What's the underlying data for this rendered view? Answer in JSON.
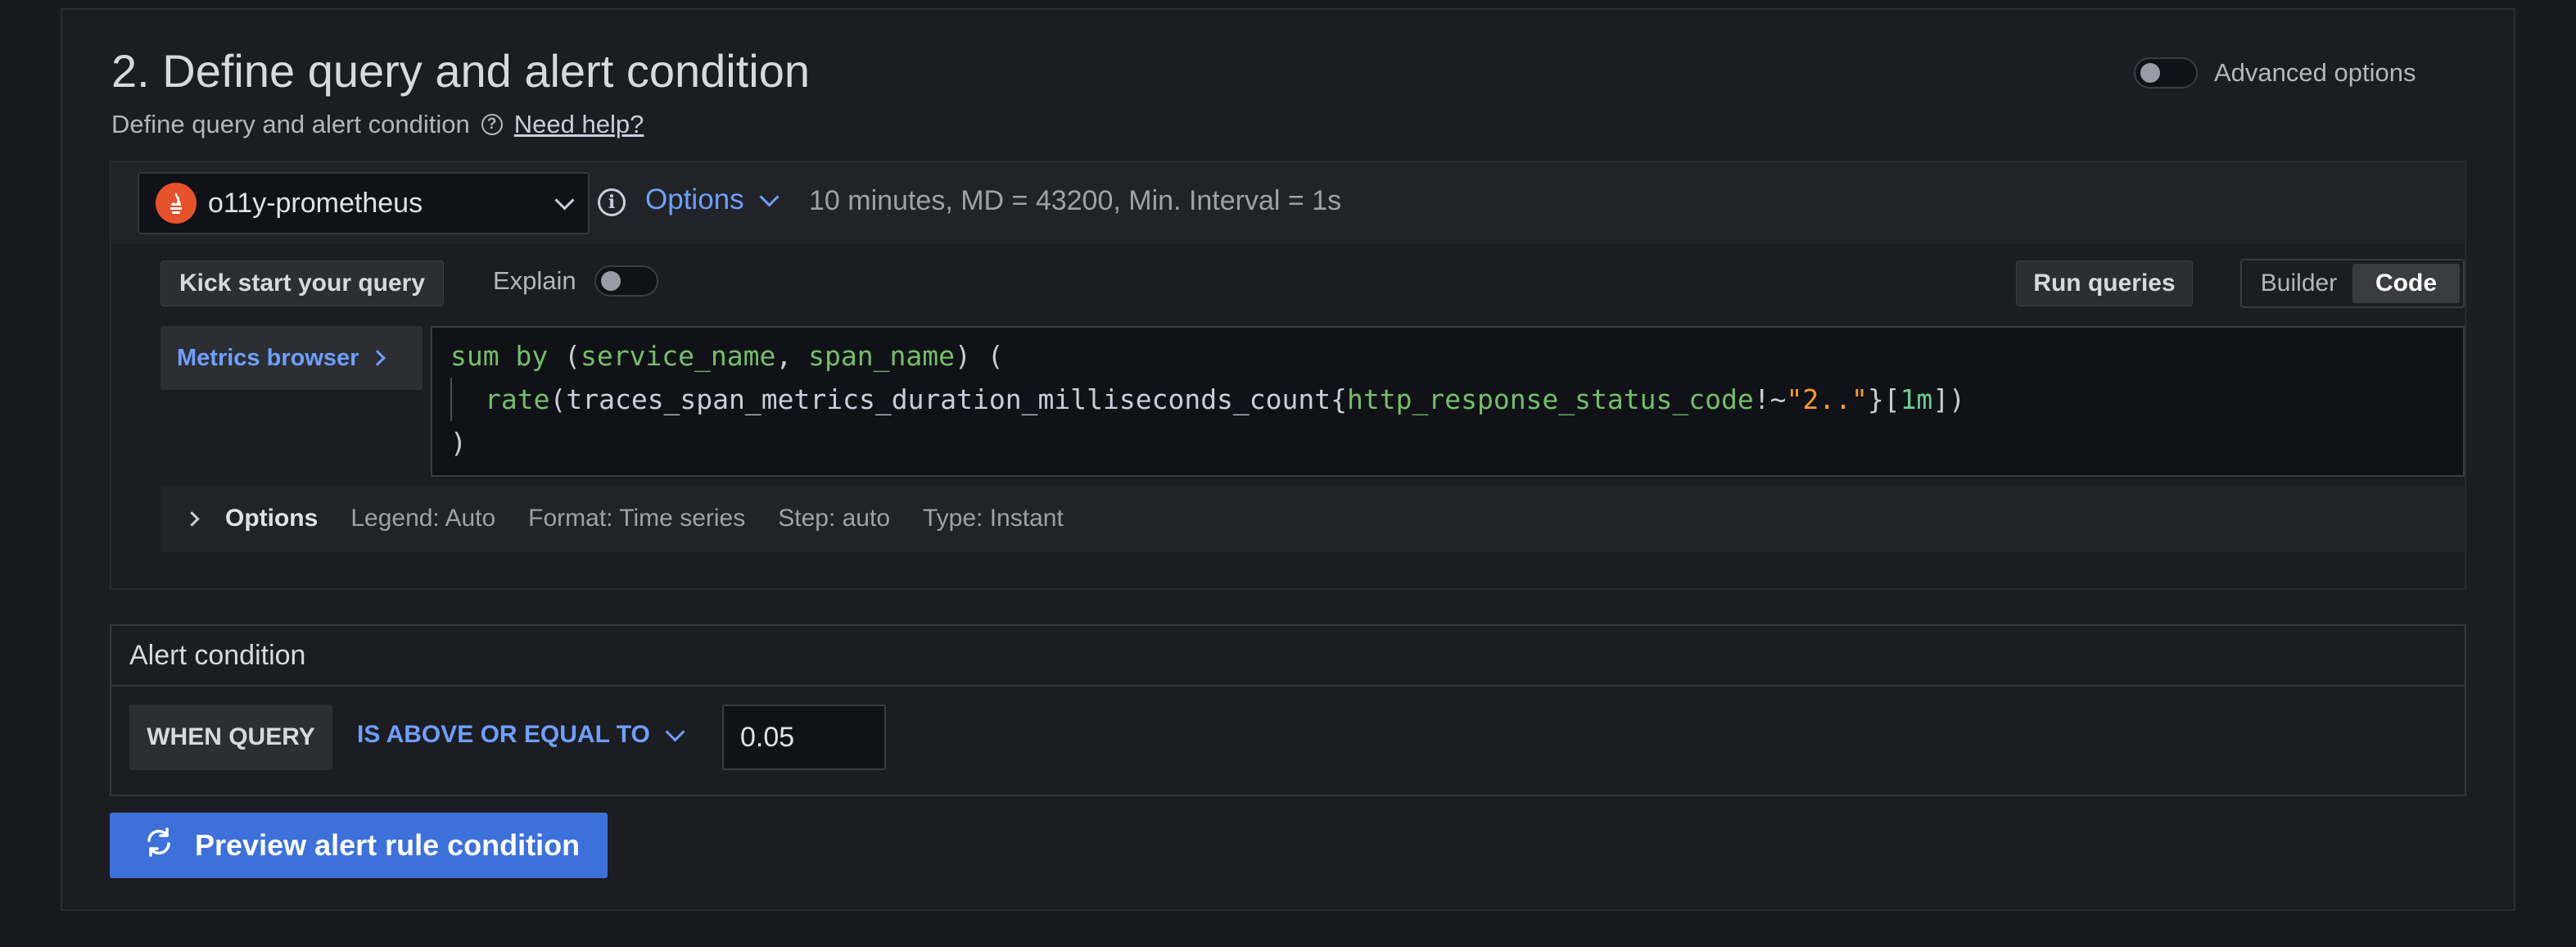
{
  "header": {
    "title": "2. Define query and alert condition",
    "subtitle": "Define query and alert condition",
    "help_link": "Need help?",
    "advanced_options_label": "Advanced options"
  },
  "query": {
    "datasource": "o11y-prometheus",
    "options_label": "Options",
    "options_summary": "10 minutes, MD = 43200, Min. Interval = 1s",
    "kick_start_label": "Kick start your query",
    "explain_label": "Explain",
    "run_queries_label": "Run queries",
    "mode_builder": "Builder",
    "mode_code": "Code",
    "metrics_browser_label": "Metrics browser",
    "code": {
      "l1_kw": "sum by",
      "l1_open": " (",
      "l1_lbl1": "service_name",
      "l1_comma": ", ",
      "l1_lbl2": "span_name",
      "l1_close": ") (",
      "l2_fn": "rate",
      "l2_metric": "(traces_span_metrics_duration_milliseconds_count{",
      "l2_label": "http_response_status_code",
      "l2_op": "!~",
      "l2_str": "\"2..\"",
      "l2_brace": "}[",
      "l2_range": "1m",
      "l2_end": "])",
      "l3": ")"
    },
    "options_row": {
      "label": "Options",
      "legend": "Legend: Auto",
      "format": "Format: Time series",
      "step": "Step: auto",
      "type": "Type: Instant"
    }
  },
  "alert_condition": {
    "title": "Alert condition",
    "when_query": "WHEN QUERY",
    "evaluator": "IS ABOVE OR EQUAL TO",
    "threshold": "0.05"
  },
  "preview_button_label": "Preview alert rule condition",
  "colors": {
    "accent_blue": "#3d71d9",
    "link_blue": "#6e9fff",
    "prometheus_orange": "#e6522c"
  }
}
